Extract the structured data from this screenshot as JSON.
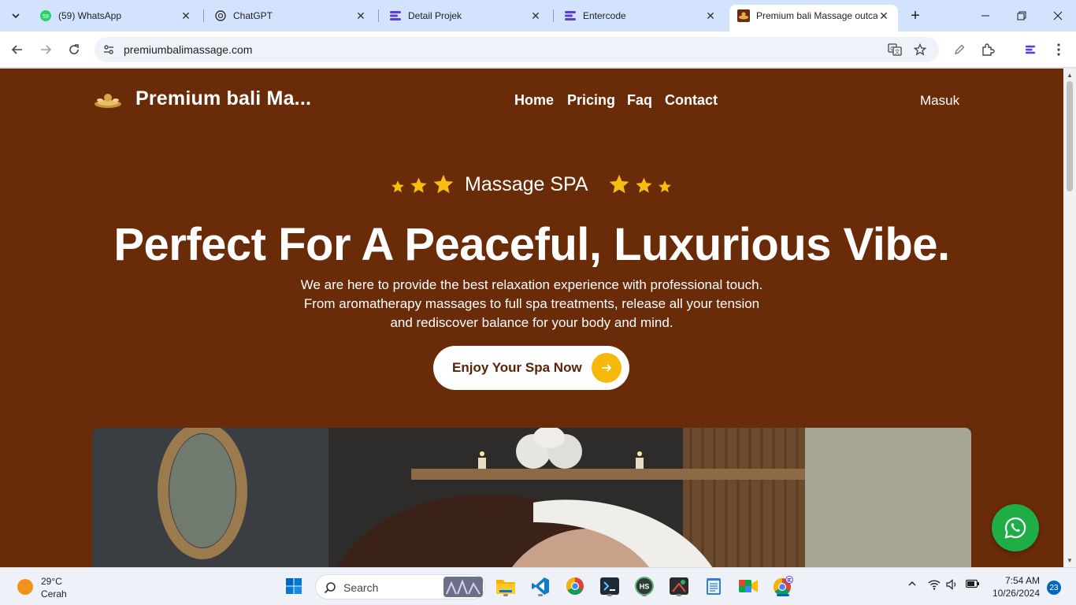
{
  "browser": {
    "tabs": [
      {
        "title": "(59) WhatsApp",
        "icon": "whatsapp-icon",
        "badge": "59"
      },
      {
        "title": "ChatGPT",
        "icon": "chatgpt-icon"
      },
      {
        "title": "Detail Projek",
        "icon": "entercode-icon"
      },
      {
        "title": "Entercode",
        "icon": "entercode-icon"
      },
      {
        "title": "Premium bali Massage outcall",
        "icon": "massage-logo-icon",
        "active": true
      }
    ],
    "url": "premiumbalimassage.com"
  },
  "site": {
    "brand": "Premium bali Ma...",
    "menu": [
      "Home",
      "Pricing",
      "Faq",
      "Contact"
    ],
    "login": "Masuk",
    "badge": "Massage SPA",
    "title": "Perfect For A Peaceful, Luxurious Vibe.",
    "description_lines": [
      "We are here to provide the best relaxation experience with professional touch.",
      "From aromatherapy massages to full spa treatments, release all your tension",
      "and rediscover balance for your body and mind."
    ],
    "cta": "Enjoy Your Spa Now",
    "colors": {
      "background": "#6a2b09",
      "accent": "#f6b90b",
      "whatsapp": "#1fae46"
    }
  },
  "taskbar": {
    "weather_temp": "29°C",
    "weather_cond": "Cerah",
    "search": "Search",
    "time": "7:54 AM",
    "date": "10/26/2024",
    "notifications": "23"
  }
}
